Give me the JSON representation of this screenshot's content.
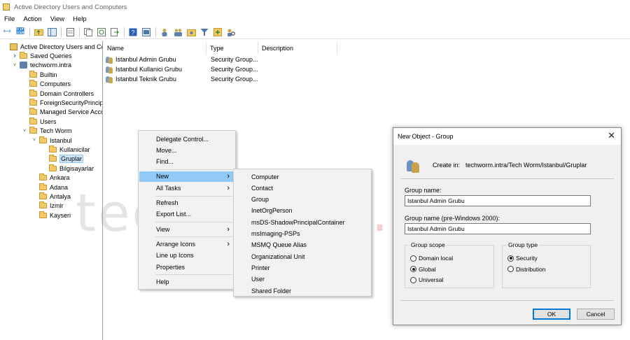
{
  "window": {
    "title": "Active Directory Users and Computers"
  },
  "menubar": [
    "File",
    "Action",
    "View",
    "Help"
  ],
  "toolbar": {
    "icons": [
      "back-arrow-icon",
      "forward-arrow-icon",
      "up-folder-icon",
      "show-console-tree-icon",
      "properties-icon",
      "copy-icon",
      "refresh-icon",
      "export-list-icon",
      "help-icon",
      "console-icon",
      "create-user-icon",
      "create-group-icon",
      "create-ou-icon",
      "filter-icon",
      "add-to-group-icon",
      "find-icon"
    ]
  },
  "tree": {
    "items": [
      {
        "label": "Active Directory Users and Com",
        "icon": "ad-root-icon",
        "depth": 0,
        "toggle": "",
        "selected": false
      },
      {
        "label": "Saved Queries",
        "icon": "folder-icon",
        "depth": 1,
        "toggle": ">",
        "selected": false
      },
      {
        "label": "techworm.intra",
        "icon": "domain-icon",
        "depth": 1,
        "toggle": "v",
        "selected": false
      },
      {
        "label": "Builtin",
        "icon": "folder-icon",
        "depth": 2,
        "toggle": "",
        "selected": false
      },
      {
        "label": "Computers",
        "icon": "folder-icon",
        "depth": 2,
        "toggle": "",
        "selected": false
      },
      {
        "label": "Domain Controllers",
        "icon": "folder-icon",
        "depth": 2,
        "toggle": "",
        "selected": false
      },
      {
        "label": "ForeignSecurityPrincipals",
        "icon": "folder-icon",
        "depth": 2,
        "toggle": "",
        "selected": false
      },
      {
        "label": "Managed Service Accour",
        "icon": "folder-icon",
        "depth": 2,
        "toggle": "",
        "selected": false
      },
      {
        "label": "Users",
        "icon": "folder-icon",
        "depth": 2,
        "toggle": "",
        "selected": false
      },
      {
        "label": "Tech Worm",
        "icon": "folder-icon",
        "depth": 2,
        "toggle": "v",
        "selected": false
      },
      {
        "label": "Istanbul",
        "icon": "folder-icon",
        "depth": 3,
        "toggle": "v",
        "selected": false
      },
      {
        "label": "Kullanicilar",
        "icon": "folder-icon",
        "depth": 4,
        "toggle": "",
        "selected": false
      },
      {
        "label": "Gruplar",
        "icon": "folder-icon",
        "depth": 4,
        "toggle": "",
        "selected": true
      },
      {
        "label": "Bilgisayarlar",
        "icon": "folder-icon",
        "depth": 4,
        "toggle": "",
        "selected": false
      },
      {
        "label": "Ankara",
        "icon": "folder-icon",
        "depth": 3,
        "toggle": "",
        "selected": false
      },
      {
        "label": "Adana",
        "icon": "folder-icon",
        "depth": 3,
        "toggle": "",
        "selected": false
      },
      {
        "label": "Antalya",
        "icon": "folder-icon",
        "depth": 3,
        "toggle": "",
        "selected": false
      },
      {
        "label": "Izmir",
        "icon": "folder-icon",
        "depth": 3,
        "toggle": "",
        "selected": false
      },
      {
        "label": "Kayseri",
        "icon": "folder-icon",
        "depth": 3,
        "toggle": "",
        "selected": false
      }
    ]
  },
  "list": {
    "columns": [
      "Name",
      "Type",
      "Description"
    ],
    "rows": [
      {
        "name": "Istanbul Admin Grubu",
        "type": "Security Group...",
        "description": ""
      },
      {
        "name": "Istanbul Kullanici Grubu",
        "type": "Security Group...",
        "description": ""
      },
      {
        "name": "Istanbul Teknik Grubu",
        "type": "Security Group...",
        "description": ""
      }
    ]
  },
  "context_menu": {
    "items": [
      {
        "label": "Delegate Control...",
        "submenu": false,
        "active": false,
        "sep_after": false
      },
      {
        "label": "Move...",
        "submenu": false,
        "active": false,
        "sep_after": false
      },
      {
        "label": "Find...",
        "submenu": false,
        "active": false,
        "sep_after": true
      },
      {
        "label": "New",
        "submenu": true,
        "active": true,
        "sep_after": false
      },
      {
        "label": "All Tasks",
        "submenu": true,
        "active": false,
        "sep_after": true
      },
      {
        "label": "Refresh",
        "submenu": false,
        "active": false,
        "sep_after": false
      },
      {
        "label": "Export List...",
        "submenu": false,
        "active": false,
        "sep_after": true
      },
      {
        "label": "View",
        "submenu": true,
        "active": false,
        "sep_after": true
      },
      {
        "label": "Arrange Icons",
        "submenu": true,
        "active": false,
        "sep_after": false
      },
      {
        "label": "Line up Icons",
        "submenu": false,
        "active": false,
        "sep_after": false
      },
      {
        "label": "Properties",
        "submenu": false,
        "active": false,
        "sep_after": true
      },
      {
        "label": "Help",
        "submenu": false,
        "active": false,
        "sep_after": false
      }
    ]
  },
  "new_submenu": {
    "items": [
      "Computer",
      "Contact",
      "Group",
      "InetOrgPerson",
      "msDS-ShadowPrincipalContainer",
      "msImaging-PSPs",
      "MSMQ Queue Alias",
      "Organizational Unit",
      "Printer",
      "User",
      "Shared Folder"
    ]
  },
  "watermark": {
    "text": "tech-worm",
    "tld": ".com"
  },
  "dialog": {
    "title": "New Object - Group",
    "create_in_label": "Create in:",
    "create_in_path": "techworm.intra/Tech Worm/Istanbul/Gruplar",
    "group_name_label": "Group name:",
    "group_name_value": "Istanbul Admin Grubu",
    "pre2000_label": "Group name (pre-Windows 2000):",
    "pre2000_value": "Istanbul Admin Grubu",
    "scope": {
      "title": "Group scope",
      "options": [
        {
          "label": "Domain local",
          "checked": false
        },
        {
          "label": "Global",
          "checked": true
        },
        {
          "label": "Universal",
          "checked": false
        }
      ]
    },
    "type": {
      "title": "Group type",
      "options": [
        {
          "label": "Security",
          "checked": true
        },
        {
          "label": "Distribution",
          "checked": false
        }
      ]
    },
    "ok_label": "OK",
    "cancel_label": "Cancel"
  }
}
